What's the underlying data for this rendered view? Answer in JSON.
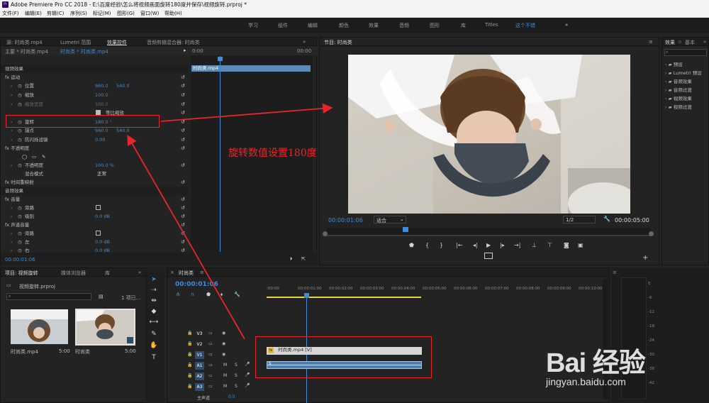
{
  "titlebar": {
    "app_icon": "Pr",
    "title": "Adobe Premiere Pro CC 2018 - E:\\百度经验\\怎么将视频画面旋转180度并保存\\视频旋转.prproj *"
  },
  "menu": [
    "文件(F)",
    "编辑(E)",
    "剪辑(C)",
    "序列(S)",
    "标记(M)",
    "图形(G)",
    "窗口(W)",
    "帮助(H)"
  ],
  "workspaces": [
    "学习",
    "组件",
    "编辑",
    "颜色",
    "效果",
    "音频",
    "图形",
    "库",
    "Titles",
    "这个不错"
  ],
  "workspaces_more": "»",
  "top_left_tabs": [
    "源: 时尚类.mp4",
    "Lumetri 范围",
    "效果控件",
    "音频剪辑混合器: 时尚类"
  ],
  "top_left_tabs_more": "»",
  "effect_controls": {
    "source": "主要 * 时尚类.mp4",
    "clip": "时尚类 * 时尚类.mp4",
    "time_start": "0:00",
    "time_end": "00:00",
    "clip_label": "时尚类.mp4",
    "rows": [
      {
        "label": "视频效果",
        "value": "",
        "value2": ""
      },
      {
        "label": "fx 运动",
        "value": "",
        "value2": ""
      },
      {
        "label": "位置",
        "value": "960.0",
        "value2": "540.0"
      },
      {
        "label": "缩放",
        "value": "100.0",
        "value2": ""
      },
      {
        "label": "缩放宽度",
        "value": "100.0",
        "value2": ""
      },
      {
        "label": "等比缩放",
        "value": "",
        "value2": ""
      },
      {
        "label": "旋转",
        "value": "180.0 °",
        "value2": ""
      },
      {
        "label": "锚点",
        "value": "960.0",
        "value2": "540.0"
      },
      {
        "label": "防闪烁滤镜",
        "value": "0.00",
        "value2": ""
      },
      {
        "label": "fx 不透明度",
        "value": "",
        "value2": ""
      },
      {
        "label": "",
        "value": "",
        "value2": ""
      },
      {
        "label": "不透明度",
        "value": "100.0 %",
        "value2": ""
      },
      {
        "label": "混合模式",
        "value": "正常",
        "value2": ""
      },
      {
        "label": "fx 时间重映射",
        "value": "",
        "value2": ""
      },
      {
        "label": "音频效果",
        "value": "",
        "value2": ""
      },
      {
        "label": "fx 音量",
        "value": "",
        "value2": ""
      },
      {
        "label": "旁路",
        "value": "",
        "value2": ""
      },
      {
        "label": "级别",
        "value": "0.0 dB",
        "value2": ""
      },
      {
        "label": "fx 声道音量",
        "value": "",
        "value2": ""
      },
      {
        "label": "旁路",
        "value": "",
        "value2": ""
      },
      {
        "label": "左",
        "value": "0.0 dB",
        "value2": ""
      },
      {
        "label": "右",
        "value": "0.0 dB",
        "value2": ""
      }
    ],
    "footer_time": "00:00:01:06"
  },
  "program": {
    "title": "节目: 时尚类",
    "more": "≡",
    "timecode": "00:00:01:06",
    "fit": "适合",
    "quality": "1/2",
    "duration": "00:00:05:00"
  },
  "effects_panel": {
    "title": "效果",
    "tab2": "基本",
    "more": "»",
    "items": [
      "预设",
      "Lumetri 预设",
      "音频效果",
      "音频过渡",
      "视频效果",
      "视频过渡"
    ]
  },
  "project": {
    "tab": "项目: 视频旋转",
    "tab2": "媒体浏览器",
    "tab3": "库",
    "more": "»",
    "file": "视频旋转.prproj",
    "count": "1 项已...",
    "items": [
      {
        "name": "时尚类.mp4",
        "duration": "5:00"
      },
      {
        "name": "时尚类",
        "duration": "5:00"
      }
    ]
  },
  "timeline": {
    "tab": "时尚类",
    "more": "≡",
    "timecode": "00:00:01:06",
    "ruler": [
      ":00:00",
      "00:00:01:00",
      "00:00:02:00",
      "00:00:03:00",
      "00:00:04:00",
      "00:00:05:00",
      "00:00:06:00",
      "00:00:07:00",
      "00:00:08:00",
      "00:00:09:00",
      "00:00:10:00"
    ],
    "tracks": [
      "V3",
      "V2",
      "V1",
      "A1",
      "A2",
      "A3"
    ],
    "master": "主声道",
    "master_val": "0.0",
    "clip_label": "时尚类.mp4 [V]",
    "audio_label": "S"
  },
  "annotation": {
    "text": "旋转数值设置180度"
  },
  "watermark": {
    "text": "Bai 经验",
    "url": "jingyan.baidu.com"
  },
  "colors": {
    "accent": "#3b8ddb",
    "annotation": "#e8262a",
    "bg": "#232323"
  }
}
